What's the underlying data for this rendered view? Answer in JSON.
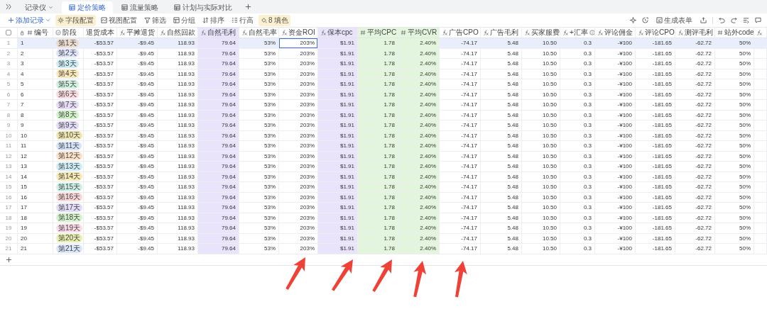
{
  "tabs": [
    {
      "label": "记录仪",
      "kind": "dropdown",
      "selected": false
    },
    {
      "label": "定价策略",
      "kind": "sheet",
      "selected": true
    },
    {
      "label": "流量策略",
      "kind": "sheet",
      "selected": false
    },
    {
      "label": "计划与实际对比",
      "kind": "sheet",
      "selected": false
    }
  ],
  "toolbar": [
    {
      "label": "添加记录",
      "kind": "add",
      "active": false
    },
    {
      "label": "字段配置",
      "kind": "gear",
      "active": true
    },
    {
      "label": "视图配置",
      "kind": "view",
      "active": false
    },
    {
      "label": "筛选",
      "kind": "filter",
      "active": false
    },
    {
      "label": "分组",
      "kind": "group",
      "active": false
    },
    {
      "label": "排序",
      "kind": "sort",
      "active": false
    },
    {
      "label": "行高",
      "kind": "rowheight",
      "active": false
    },
    {
      "label": "8 填色",
      "kind": "fill",
      "active": true
    }
  ],
  "form_button": "生成表单",
  "select_all": {
    "checked": false
  },
  "columns": [
    {
      "label": "编号"
    },
    {
      "label": "阶段"
    },
    {
      "label": "退货成本"
    },
    {
      "label": "平摊退货"
    },
    {
      "label": "自然回款"
    },
    {
      "label": "自然毛利",
      "color": "#e9e3fb"
    },
    {
      "label": "自然毛率"
    },
    {
      "label": "资金ROI",
      "focused": true
    },
    {
      "label": "保本cpc",
      "color": "#e9e3fb"
    },
    {
      "label": "平均CPC",
      "color": "#e3f6dd"
    },
    {
      "label": "平均CVR",
      "color": "#e3f6dd"
    },
    {
      "label": "广告CPO"
    },
    {
      "label": "广告毛利"
    },
    {
      "label": "买家服费"
    },
    {
      "label": "+汇率"
    },
    {
      "label": "评论佣金"
    },
    {
      "label": "评论CPO"
    },
    {
      "label": "测评毛利"
    },
    {
      "label": "站外code"
    }
  ],
  "rows": [
    {
      "index": "1",
      "num": "1",
      "stage": "第1天",
      "color": "#eddccc",
      "selected": true,
      "cells": [
        "-$53.57",
        "-$9.45",
        "118.93",
        "79.64",
        "53%",
        "203%",
        "$1.91",
        "1.78",
        "2.40%",
        "-74.17",
        "5.48",
        "10.50",
        "0.3",
        "-¥100",
        "-181.65",
        "-62.72",
        "50%"
      ]
    },
    {
      "index": "2",
      "num": "2",
      "stage": "第2天",
      "color": "#dfe5fb",
      "selected": false,
      "cells": [
        "-$53.57",
        "-$9.45",
        "118.93",
        "79.64",
        "53%",
        "203%",
        "$1.91",
        "1.78",
        "2.40%",
        "-74.17",
        "5.48",
        "10.50",
        "0.3",
        "-¥100",
        "-181.65",
        "-62.72",
        "50%"
      ]
    },
    {
      "index": "3",
      "num": "3",
      "stage": "第3天",
      "color": "#cdeef6",
      "selected": false,
      "cells": [
        "-$53.57",
        "-$9.45",
        "118.93",
        "79.64",
        "53%",
        "203%",
        "$1.91",
        "1.78",
        "2.40%",
        "-74.17",
        "5.48",
        "10.50",
        "0.3",
        "-¥100",
        "-181.65",
        "-62.72",
        "50%"
      ]
    },
    {
      "index": "4",
      "num": "4",
      "stage": "第4天",
      "color": "#fbe8b8",
      "selected": false,
      "cells": [
        "-$53.57",
        "-$9.45",
        "118.93",
        "79.64",
        "53%",
        "203%",
        "$1.91",
        "1.78",
        "2.40%",
        "-74.17",
        "5.48",
        "10.50",
        "0.3",
        "-¥100",
        "-181.65",
        "-62.72",
        "50%"
      ]
    },
    {
      "index": "5",
      "num": "5",
      "stage": "第5天",
      "color": "#cff3df",
      "selected": false,
      "cells": [
        "-$53.57",
        "-$9.45",
        "118.93",
        "79.64",
        "53%",
        "203%",
        "$1.91",
        "1.78",
        "2.40%",
        "-74.17",
        "5.48",
        "10.50",
        "0.3",
        "-¥100",
        "-181.65",
        "-62.72",
        "50%"
      ]
    },
    {
      "index": "6",
      "num": "6",
      "stage": "第6天",
      "color": "#fbdbe2",
      "selected": false,
      "cells": [
        "-$53.57",
        "-$9.45",
        "118.93",
        "79.64",
        "53%",
        "203%",
        "$1.91",
        "1.78",
        "2.40%",
        "-74.17",
        "5.48",
        "10.50",
        "0.3",
        "-¥100",
        "-181.65",
        "-62.72",
        "50%"
      ]
    },
    {
      "index": "7",
      "num": "7",
      "stage": "第7天",
      "color": "#e6dcf8",
      "selected": false,
      "cells": [
        "-$53.57",
        "-$9.45",
        "118.93",
        "79.64",
        "53%",
        "203%",
        "$1.91",
        "1.78",
        "2.40%",
        "-74.17",
        "5.48",
        "10.50",
        "0.3",
        "-¥100",
        "-181.65",
        "-62.72",
        "50%"
      ]
    },
    {
      "index": "8",
      "num": "8",
      "stage": "第8天",
      "color": "#d3f3cb",
      "selected": false,
      "cells": [
        "-$53.57",
        "-$9.45",
        "118.93",
        "79.64",
        "53%",
        "203%",
        "$1.91",
        "1.78",
        "2.40%",
        "-74.17",
        "5.48",
        "10.50",
        "0.3",
        "-¥100",
        "-181.65",
        "-62.72",
        "50%"
      ]
    },
    {
      "index": "9",
      "num": "9",
      "stage": "第9天",
      "color": "#e3dcf6",
      "selected": false,
      "cells": [
        "-$53.57",
        "-$9.45",
        "118.93",
        "79.64",
        "53%",
        "203%",
        "$1.91",
        "1.78",
        "2.40%",
        "-74.17",
        "5.48",
        "10.50",
        "0.3",
        "-¥100",
        "-181.65",
        "-62.72",
        "50%"
      ]
    },
    {
      "index": "10",
      "num": "10",
      "stage": "第10天",
      "color": "#f0e7b0",
      "selected": false,
      "cells": [
        "-$53.57",
        "-$9.45",
        "118.93",
        "79.64",
        "53%",
        "203%",
        "$1.91",
        "1.78",
        "2.40%",
        "-74.17",
        "5.48",
        "10.50",
        "0.3",
        "-¥100",
        "-181.65",
        "-62.72",
        "50%"
      ]
    },
    {
      "index": "11",
      "num": "11",
      "stage": "第11天",
      "color": "#d7e3fa",
      "selected": false,
      "cells": [
        "-$53.57",
        "-$9.45",
        "118.93",
        "79.64",
        "53%",
        "203%",
        "$1.91",
        "1.78",
        "2.40%",
        "-74.17",
        "5.48",
        "10.50",
        "0.3",
        "-¥100",
        "-181.65",
        "-62.72",
        "50%"
      ]
    },
    {
      "index": "12",
      "num": "12",
      "stage": "第12天",
      "color": "#fbe2c8",
      "selected": false,
      "cells": [
        "-$53.57",
        "-$9.45",
        "118.93",
        "79.64",
        "53%",
        "203%",
        "$1.91",
        "1.78",
        "2.40%",
        "-74.17",
        "5.48",
        "10.50",
        "0.3",
        "-¥100",
        "-181.65",
        "-62.72",
        "50%"
      ]
    },
    {
      "index": "13",
      "num": "13",
      "stage": "第13天",
      "color": "#cdeef6",
      "selected": false,
      "cells": [
        "-$53.57",
        "-$9.45",
        "118.93",
        "79.64",
        "53%",
        "203%",
        "$1.91",
        "1.78",
        "2.40%",
        "-74.17",
        "5.48",
        "10.50",
        "0.3",
        "-¥100",
        "-181.65",
        "-62.72",
        "50%"
      ]
    },
    {
      "index": "14",
      "num": "14",
      "stage": "第14天",
      "color": "#f8eab6",
      "selected": false,
      "cells": [
        "-$53.57",
        "-$9.45",
        "118.93",
        "79.64",
        "53%",
        "203%",
        "$1.91",
        "1.78",
        "2.40%",
        "-74.17",
        "5.48",
        "10.50",
        "0.3",
        "-¥100",
        "-181.65",
        "-62.72",
        "50%"
      ]
    },
    {
      "index": "15",
      "num": "15",
      "stage": "第15天",
      "color": "#cdf0e8",
      "selected": false,
      "cells": [
        "-$53.57",
        "-$9.45",
        "118.93",
        "79.64",
        "53%",
        "203%",
        "$1.91",
        "1.78",
        "2.40%",
        "-74.17",
        "5.48",
        "10.50",
        "0.3",
        "-¥100",
        "-181.65",
        "-62.72",
        "50%"
      ]
    },
    {
      "index": "16",
      "num": "16",
      "stage": "第16天",
      "color": "#f9d8d8",
      "selected": false,
      "cells": [
        "-$53.57",
        "-$9.45",
        "118.93",
        "79.64",
        "53%",
        "203%",
        "$1.91",
        "1.78",
        "2.40%",
        "-74.17",
        "5.48",
        "10.50",
        "0.3",
        "-¥100",
        "-181.65",
        "-62.72",
        "50%"
      ]
    },
    {
      "index": "17",
      "num": "17",
      "stage": "第17天",
      "color": "#e2dcf8",
      "selected": false,
      "cells": [
        "-$53.57",
        "-$9.45",
        "118.93",
        "79.64",
        "53%",
        "203%",
        "$1.91",
        "1.78",
        "2.40%",
        "-74.17",
        "5.48",
        "10.50",
        "0.3",
        "-¥100",
        "-181.65",
        "-62.72",
        "50%"
      ]
    },
    {
      "index": "18",
      "num": "18",
      "stage": "第18天",
      "color": "#d3f3cb",
      "selected": false,
      "cells": [
        "-$53.57",
        "-$9.45",
        "118.93",
        "79.64",
        "53%",
        "203%",
        "$1.91",
        "1.78",
        "2.40%",
        "-74.17",
        "5.48",
        "10.50",
        "0.3",
        "-¥100",
        "-181.65",
        "-62.72",
        "50%"
      ]
    },
    {
      "index": "19",
      "num": "19",
      "stage": "第19天",
      "color": "#fbdbe8",
      "selected": false,
      "cells": [
        "-$53.57",
        "-$9.45",
        "118.93",
        "79.64",
        "53%",
        "203%",
        "$1.91",
        "1.78",
        "2.40%",
        "-74.17",
        "5.48",
        "10.50",
        "0.3",
        "-¥100",
        "-181.65",
        "-62.72",
        "50%"
      ]
    },
    {
      "index": "20",
      "num": "20",
      "stage": "第20天",
      "color": "#e8efb0",
      "selected": false,
      "cells": [
        "-$53.57",
        "-$9.45",
        "118.93",
        "79.64",
        "53%",
        "203%",
        "$1.91",
        "1.78",
        "2.40%",
        "-74.17",
        "5.48",
        "10.50",
        "0.3",
        "-¥100",
        "-181.65",
        "-62.72",
        "50%"
      ]
    },
    {
      "index": "21",
      "num": "21",
      "stage": "第21天",
      "color": "#dce6fb",
      "selected": false,
      "cells": [
        "-$53.57",
        "-$9.45",
        "118.93",
        "79.64",
        "53%",
        "203%",
        "$1.91",
        "1.78",
        "2.40%",
        "-74.17",
        "5.48",
        "10.50",
        "0.3",
        "-¥100",
        "-181.65",
        "-62.72",
        "50%"
      ]
    }
  ]
}
